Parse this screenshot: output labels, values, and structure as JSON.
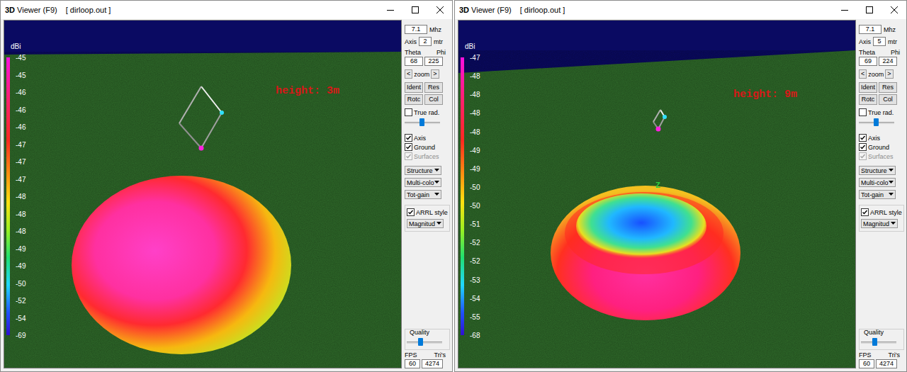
{
  "windows": [
    {
      "logo": "3D",
      "title": "Viewer (F9)",
      "file": "[ dirloop.out ]",
      "scene": {
        "unit": "dBi",
        "scale": [
          "-45",
          "-45",
          "-46",
          "-46",
          "-46",
          "-47",
          "-47",
          "-47",
          "-48",
          "-48",
          "-48",
          "-49",
          "-49",
          "-50",
          "-52",
          "-54",
          "-69"
        ],
        "annotation": "height: 3m",
        "antenna": {
          "kind": "near"
        },
        "pattern": {
          "kind": "dome"
        },
        "axis_marker": null
      },
      "panel": {
        "frequency": "7.1",
        "frequency_unit": "Mhz",
        "axis_label": "Axis",
        "axis": "2",
        "axis_unit": "mtr",
        "theta_label": "Theta",
        "phi_label": "Phi",
        "theta": "68",
        "phi": "225",
        "zoom_prev": "<",
        "zoom_label": "zoom",
        "zoom_next": ">",
        "buttons": [
          "Ident",
          "Res",
          "Rotc",
          "Col"
        ],
        "true_rad": {
          "label": "True rad.",
          "checked": false
        },
        "true_rad_slider": {
          "level": 0.5
        },
        "display_checks": [
          {
            "label": "Axis",
            "checked": true,
            "disabled": false
          },
          {
            "label": "Ground",
            "checked": true,
            "disabled": false
          },
          {
            "label": "Surfaces",
            "checked": true,
            "disabled": true
          }
        ],
        "dropdowns": [
          "Structure",
          "Multi-colo",
          "Tot-gain"
        ],
        "arrl": {
          "label": "ARRL style",
          "checked": true
        },
        "arrl_dropdown": "Magnitud",
        "quality": {
          "label": "Quality",
          "level": 0.4
        },
        "fps_label": "FPS",
        "tris_label": "Tri's",
        "fps": "60",
        "tris": "4274"
      }
    },
    {
      "logo": "3D",
      "title": "Viewer (F9)",
      "file": "[ dirloop.out ]",
      "scene": {
        "unit": "dBi",
        "scale": [
          "-47",
          "-48",
          "-48",
          "-48",
          "-48",
          "-49",
          "-49",
          "-50",
          "-50",
          "-51",
          "-52",
          "-52",
          "-53",
          "-54",
          "-55",
          "-68"
        ],
        "annotation": "height: 9m",
        "antenna": {
          "kind": "far"
        },
        "pattern": {
          "kind": "torus"
        },
        "axis_marker": "Z"
      },
      "panel": {
        "frequency": "7.1",
        "frequency_unit": "Mhz",
        "axis_label": "Axis",
        "axis": "5",
        "axis_unit": "mtr",
        "theta_label": "Theta",
        "phi_label": "Phi",
        "theta": "69",
        "phi": "224",
        "zoom_prev": "<",
        "zoom_label": "zoom",
        "zoom_next": ">",
        "buttons": [
          "Ident",
          "Res",
          "Rotc",
          "Col"
        ],
        "true_rad": {
          "label": "True rad.",
          "checked": false
        },
        "true_rad_slider": {
          "level": 0.5
        },
        "display_checks": [
          {
            "label": "Axis",
            "checked": true,
            "disabled": false
          },
          {
            "label": "Ground",
            "checked": true,
            "disabled": false
          },
          {
            "label": "Surfaces",
            "checked": true,
            "disabled": true
          }
        ],
        "dropdowns": [
          "Structure",
          "Multi-colo",
          "Tot-gain"
        ],
        "arrl": {
          "label": "ARRL style",
          "checked": true
        },
        "arrl_dropdown": "Magnitud",
        "quality": {
          "label": "Quality",
          "level": 0.4
        },
        "fps_label": "FPS",
        "tris_label": "Tri's",
        "fps": "60",
        "tris": "4274"
      }
    }
  ]
}
